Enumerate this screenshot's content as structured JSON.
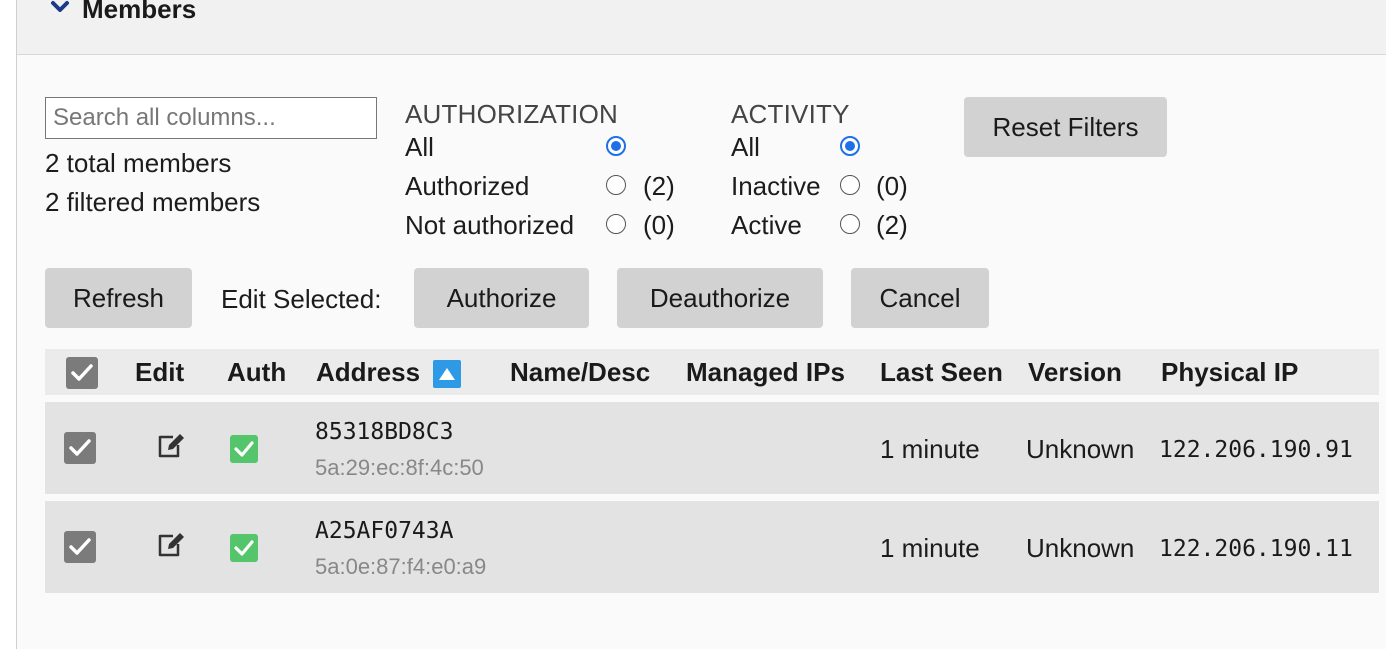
{
  "panel": {
    "title": "Members"
  },
  "search": {
    "placeholder": "Search all columns..."
  },
  "summary": {
    "total": "2 total members",
    "filtered": "2 filtered members"
  },
  "authorization_filter": {
    "label": "AUTHORIZATION",
    "options": [
      {
        "label": "All",
        "count": "",
        "selected": true
      },
      {
        "label": "Authorized",
        "count": "(2)",
        "selected": false
      },
      {
        "label": "Not authorized",
        "count": "(0)",
        "selected": false
      }
    ]
  },
  "activity_filter": {
    "label": "ACTIVITY",
    "options": [
      {
        "label": "All",
        "count": "",
        "selected": true
      },
      {
        "label": "Inactive",
        "count": "(0)",
        "selected": false
      },
      {
        "label": "Active",
        "count": "(2)",
        "selected": false
      }
    ]
  },
  "buttons": {
    "reset_filters": "Reset Filters",
    "refresh": "Refresh",
    "edit_selected_label": "Edit Selected:",
    "authorize": "Authorize",
    "deauthorize": "Deauthorize",
    "cancel": "Cancel"
  },
  "table": {
    "columns": [
      "Edit",
      "Auth",
      "Address",
      "Name/Desc",
      "Managed IPs",
      "Last Seen",
      "Version",
      "Physical IP"
    ],
    "sort": {
      "column": "Address",
      "direction": "ascending"
    },
    "rows": [
      {
        "selected": true,
        "authorized": true,
        "address": "85318BD8C3",
        "mac": "5a:29:ec:8f:4c:50",
        "name": "",
        "managed_ips": "",
        "last_seen": "1 minute",
        "version": "Unknown",
        "physical_ip": "122.206.190.91"
      },
      {
        "selected": true,
        "authorized": true,
        "address": "A25AF0743A",
        "mac": "5a:0e:87:f4:e0:a9",
        "name": "",
        "managed_ips": "",
        "last_seen": "1 minute",
        "version": "Unknown",
        "physical_ip": "122.206.190.11"
      }
    ]
  },
  "colors": {
    "accent": "#1e6fe8",
    "auth_green": "#55c56b",
    "checkbox_gray": "#7b7b7b",
    "button_gray": "#d2d2d2"
  }
}
